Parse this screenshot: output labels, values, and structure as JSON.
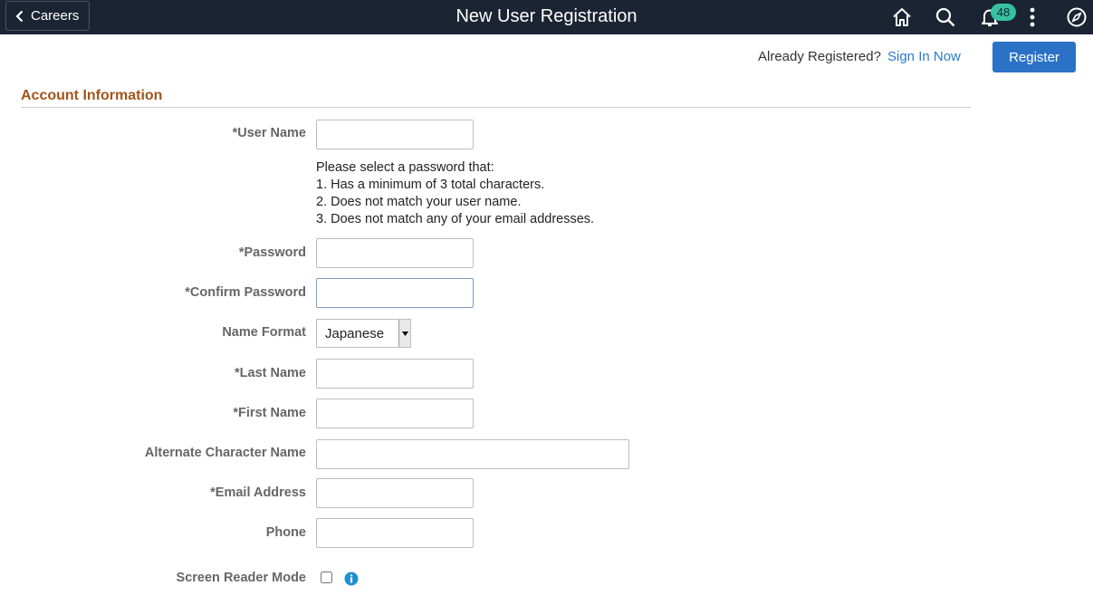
{
  "header": {
    "back_label": "Careers",
    "title": "New User Registration",
    "notification_count": "48"
  },
  "actions": {
    "already_registered": "Already Registered?",
    "sign_in_link": "Sign In Now",
    "register_label": "Register"
  },
  "section": {
    "title": "Account Information"
  },
  "form": {
    "user_name_label": "*User Name",
    "password_help": [
      "Please select a password that:",
      "1. Has a minimum of 3 total characters.",
      "2. Does not match your user name.",
      "3. Does not match any of your email addresses."
    ],
    "password_label": "*Password",
    "confirm_password_label": "*Confirm Password",
    "name_format_label": "Name Format",
    "name_format_value": "Japanese",
    "last_name_label": "*Last Name",
    "first_name_label": "*First Name",
    "alt_char_name_label": "Alternate Character Name",
    "email_label": "*Email Address",
    "phone_label": "Phone",
    "screen_reader_label": "Screen Reader Mode"
  },
  "colors": {
    "topbar": "#1b2432",
    "accent": "#2b72c7",
    "section_title": "#a0561b",
    "badge": "#36c1a1"
  },
  "icons": [
    "chevron-left-icon",
    "home-icon",
    "search-icon",
    "bell-icon",
    "more-vertical-icon",
    "compass-icon",
    "info-icon",
    "dropdown-arrow-icon"
  ]
}
